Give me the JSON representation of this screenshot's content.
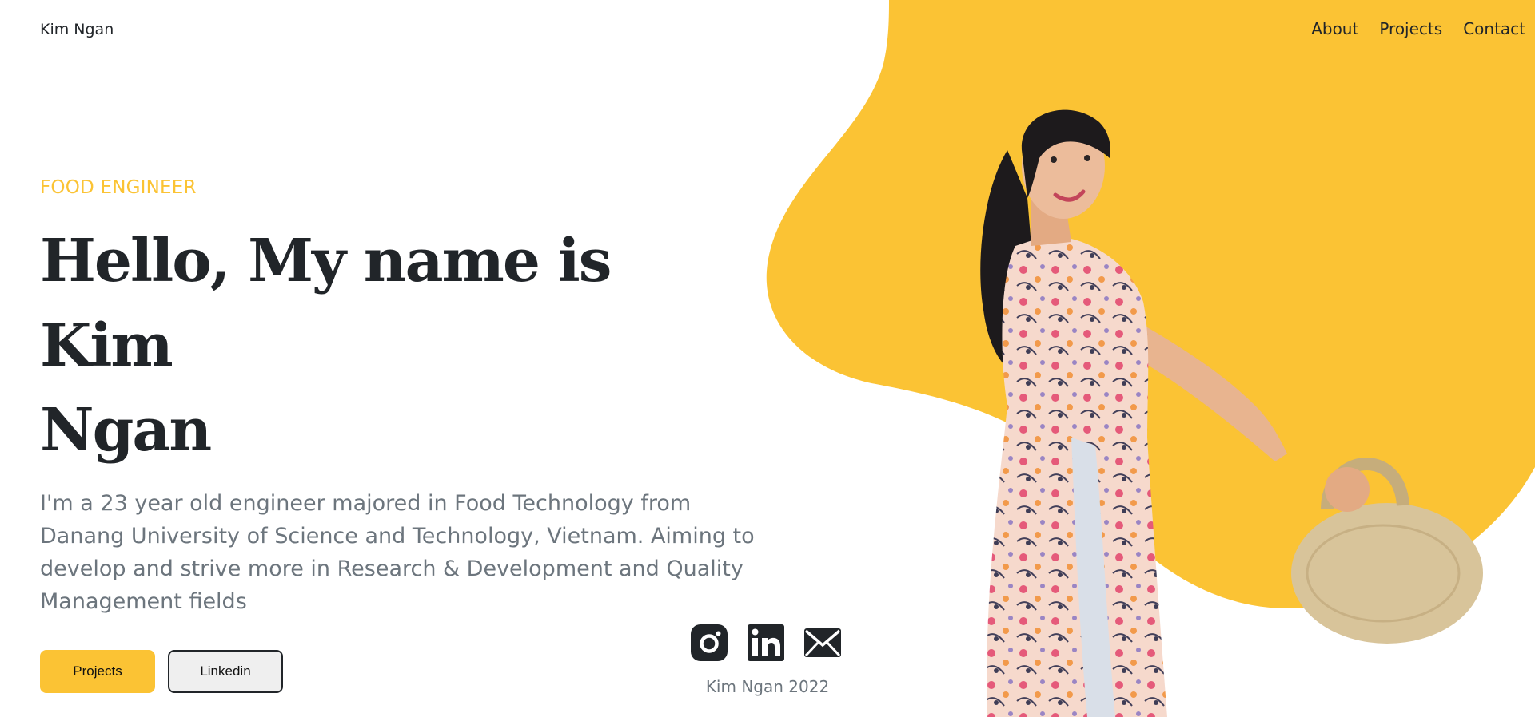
{
  "header": {
    "brand": "Kim Ngan",
    "nav": [
      {
        "label": "About"
      },
      {
        "label": "Projects"
      },
      {
        "label": "Contact"
      }
    ]
  },
  "hero": {
    "eyebrow": "FOOD ENGINEER",
    "headline_line1": "Hello, My name is Kim",
    "headline_line2": "Ngan",
    "intro": "I'm a 23 year old engineer majored in Food Technology from Danang University of Science and Technology, Vietnam. Aiming to develop and strive more in Research & Development and Quality Management fields",
    "buttons": {
      "primary": "Projects",
      "secondary": "Linkedin"
    }
  },
  "social": [
    {
      "icon": "instagram-icon"
    },
    {
      "icon": "linkedin-icon"
    },
    {
      "icon": "mail-icon"
    }
  ],
  "footer": {
    "copyright": "Kim Ngan 2022"
  },
  "colors": {
    "accent": "#fbc334",
    "text_dark": "#212529",
    "text_muted": "#6c757d"
  }
}
